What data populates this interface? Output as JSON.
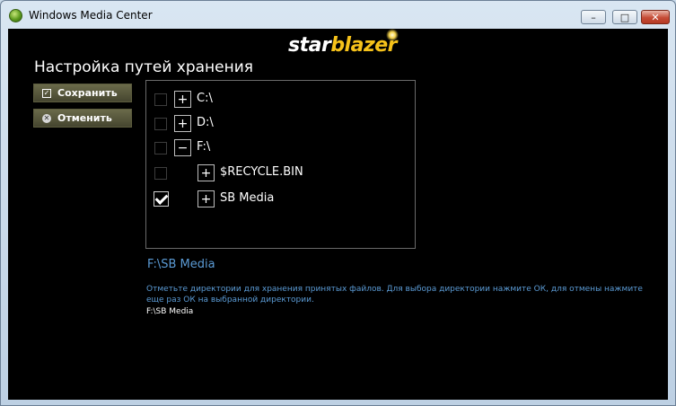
{
  "window": {
    "title": "Windows Media Center"
  },
  "logo": {
    "part1": "star",
    "part2": "blazer"
  },
  "page": {
    "title": "Настройка путей хранения"
  },
  "buttons": {
    "save": "Сохранить",
    "cancel": "Отменить"
  },
  "tree": [
    {
      "label": "C:\\",
      "expander": "+",
      "checked": false
    },
    {
      "label": "D:\\",
      "expander": "+",
      "checked": false
    },
    {
      "label": "F:\\",
      "expander": "−",
      "checked": false
    },
    {
      "label": "$RECYCLE.BIN",
      "expander": "+",
      "checked": false
    },
    {
      "label": "SB Media",
      "expander": "+",
      "checked": true
    }
  ],
  "selected_path": "F:\\SB Media",
  "hint": "Отметьте директории для хранения принятых файлов. Для выбора директории нажмите ОК, для отмены нажмите еще раз ОК на выбранной директории.",
  "selected_list": "F:\\SB Media",
  "controls": {
    "minimize": "–",
    "maximize": "□",
    "close": "✕"
  },
  "colors": {
    "accent_text": "#5b9bd5",
    "button_bg": "#55553a"
  }
}
